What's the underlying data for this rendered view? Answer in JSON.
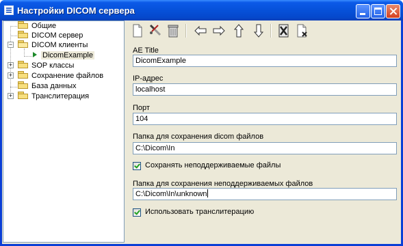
{
  "window": {
    "title": "Настройки DICOM сервера"
  },
  "tree": {
    "items": [
      {
        "label": "Общие",
        "expander": ""
      },
      {
        "label": "DICOM сервер",
        "expander": ""
      },
      {
        "label": "DICOM клиенты",
        "expander": "−"
      },
      {
        "label": "DicomExample",
        "expander": ""
      },
      {
        "label": "SOP классы",
        "expander": "+"
      },
      {
        "label": "Сохранение файлов",
        "expander": "+"
      },
      {
        "label": "База данных",
        "expander": ""
      },
      {
        "label": "Транслитерация",
        "expander": "+"
      }
    ]
  },
  "toolbar": {
    "icons": [
      "new-document-icon",
      "edit-tool-icon",
      "trash-icon",
      "arrow-left-icon",
      "arrow-right-icon",
      "arrow-up-icon",
      "arrow-down-icon",
      "delete-document-icon",
      "remove-document-icon"
    ]
  },
  "form": {
    "ae_title_label": "AE Title",
    "ae_title_value": "DicomExample",
    "ip_label": "IP-адрес",
    "ip_value": "localhost",
    "port_label": "Порт",
    "port_value": "104",
    "dicom_folder_label": "Папка для сохранения dicom файлов",
    "dicom_folder_value": "C:\\Dicom\\In",
    "save_unsupported_label": "Сохранять неподдерживаемые файлы",
    "save_unsupported_checked": true,
    "unsupported_folder_label": "Папка для сохранения неподдерживаемых файлов",
    "unsupported_folder_value": "C:\\Dicom\\In\\unknown",
    "use_translit_label": "Использовать транслитерацию",
    "use_translit_checked": true
  }
}
